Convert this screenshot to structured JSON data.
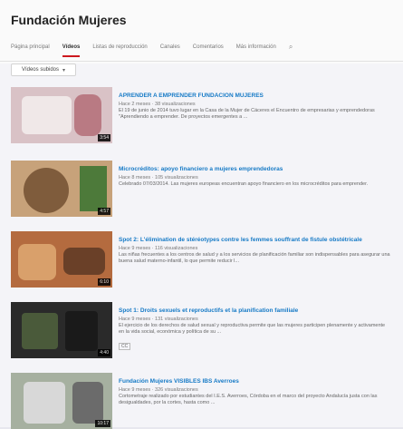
{
  "channel": {
    "title": "Fundación Mujeres"
  },
  "tabs": [
    {
      "label": "Página principal",
      "active": false
    },
    {
      "label": "Vídeos",
      "active": true
    },
    {
      "label": "Listas de reproducción",
      "active": false
    },
    {
      "label": "Canales",
      "active": false
    },
    {
      "label": "Comentarios",
      "active": false
    },
    {
      "label": "Más información",
      "active": false
    }
  ],
  "filter": {
    "label": "Vídeos subidos"
  },
  "videos": [
    {
      "title": "APRENDER A EMPRENDER FUNDACION MUJERES",
      "meta": "Hace 2 meses · 38 visualizaciones",
      "desc": "El 19 de junio de 2014 tuvo lugar en la Casa de la Mujer de Cáceres el Encuentro de empresarias y emprendedoras \"Aprendiendo a emprender. De proyectos emergentes a ...",
      "duration": "3:54",
      "colors": [
        "#d9c2c6",
        "#f0e8e8",
        "#b97a83"
      ]
    },
    {
      "title": "Microcréditos: apoyo financiero a mujeres emprendedoras",
      "meta": "Hace 8 meses · 105 visualizaciones",
      "desc": "Celebrado 07/03/2014. Las mujeres europeas encuentran apoyo financiero en los microcréditos para emprender.",
      "duration": "4:57",
      "colors": [
        "#c7a27a",
        "#7f5c3c",
        "#4d7a3a"
      ]
    },
    {
      "title": "Spot 2: L'élimination de stéréotypes contre les femmes souffrant de fistule obstétricale",
      "meta": "Hace 9 meses · 116 visualizaciones",
      "desc": "Las niñas frecuentes a los centros de salud y a los servicios de planificación familiar son indispensables para asegurar una buena salud materno-infantil, lo que permite reducir l...",
      "duration": "6:10",
      "colors": [
        "#b46b3f",
        "#d9a06b",
        "#6a4028"
      ]
    },
    {
      "title": "Spot 1: Droits sexuels et reproductifs et la planification familiale",
      "meta": "Hace 9 meses · 131 visualizaciones",
      "desc": "El ejercicio de los derechos de salud sexual y reproductiva permite que las mujeres participen plenamente y activamente en la vida social, económica y política de su ...",
      "cc": "CC",
      "duration": "4:40",
      "colors": [
        "#2a2a2a",
        "#4a5a3a",
        "#1a1a1a"
      ]
    },
    {
      "title": "Fundación Mujeres VISIBLES IBS Averroes",
      "meta": "Hace 9 meses · 326 visualizaciones",
      "desc": "Cortometraje realizado por estudiantes del I.E.S. Averroes, Córdoba en el marco del proyecto Andalucía justa con las desigualdades, por la cortes, hasta como ...",
      "duration": "10:17",
      "colors": [
        "#a6b0a0",
        "#d8d8d8",
        "#6b6b6b"
      ]
    }
  ]
}
